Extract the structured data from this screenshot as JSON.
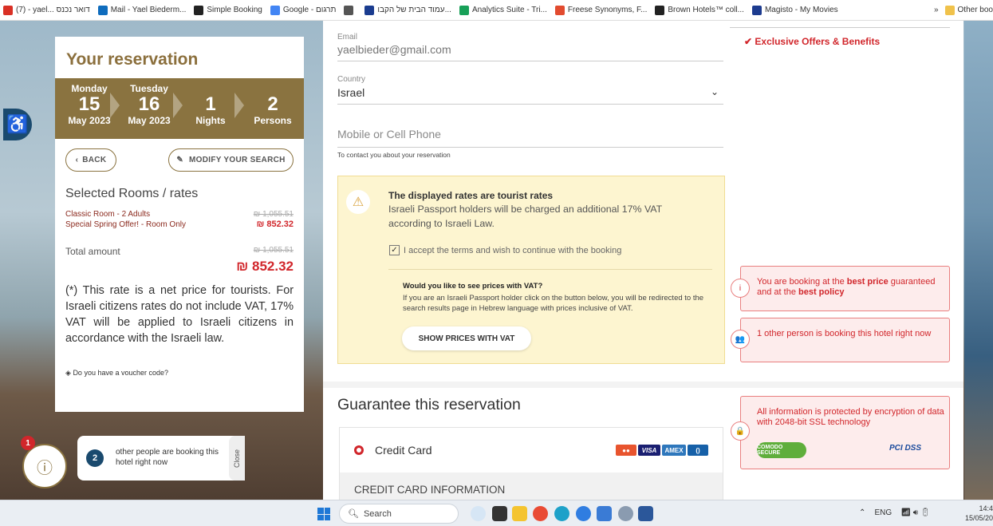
{
  "bookmarks": [
    {
      "label": "(7) - yael... דואר נכנס",
      "icon": "gmail-icon",
      "color": "#d93025"
    },
    {
      "label": "Mail - Yael Biederm...",
      "icon": "outlook-icon",
      "color": "#0f6cbd"
    },
    {
      "label": "Simple Booking",
      "icon": "sb-icon",
      "color": "#222222"
    },
    {
      "label": "Google - תרגום",
      "icon": "translate-icon",
      "color": "#4285f4"
    },
    {
      "label": "",
      "icon": "globe-icon",
      "color": "#555555"
    },
    {
      "label": "עמוד הבית של הקבו...",
      "icon": "b-icon",
      "color": "#1a3c8f"
    },
    {
      "label": "Analytics Suite - Tri...",
      "icon": "analytics-icon",
      "color": "#18a058"
    },
    {
      "label": "Freese Synonyms, F...",
      "icon": "freese-icon",
      "color": "#e24b2f"
    },
    {
      "label": "Brown Hotels™ coll...",
      "icon": "brown-icon",
      "color": "#222222"
    },
    {
      "label": "Magisto - My Movies",
      "icon": "magisto-icon",
      "color": "#1d3b8f"
    }
  ],
  "bookmarks_more": "»",
  "bookmarks_other": "Other boo",
  "reservation": {
    "title": "Your reservation",
    "checkin": {
      "day": "Monday",
      "date": "15",
      "month": "May 2023"
    },
    "checkout": {
      "day": "Tuesday",
      "date": "16",
      "month": "May 2023"
    },
    "nights": {
      "value": "1",
      "label": "Nights"
    },
    "persons": {
      "value": "2",
      "label": "Persons"
    },
    "back_label": "BACK",
    "modify_label": "MODIFY YOUR SEARCH",
    "rooms_heading": "Selected Rooms / rates",
    "room_line1": {
      "label": "Classic Room - 2 Adults",
      "old_price": "₪ 1,055.51"
    },
    "room_line2": {
      "label": "Special Spring Offer! - Room Only",
      "price": "₪ 852.32"
    },
    "total_label": "Total amount",
    "total_old": "₪ 1,055.51",
    "total_new": "₪ 852.32",
    "note": "(*) This rate is a net price for tourists. For Israeli citizens rates do not include VAT, 17% VAT will be applied to Israeli citizens in accordance with the Israeli law.",
    "voucher": "Do you have a voucher code?"
  },
  "form": {
    "email_label": "Email",
    "email_value": "yaelbieder@gmail.com",
    "country_label": "Country",
    "country_value": "Israel",
    "phone_placeholder": "Mobile or Cell Phone",
    "phone_hint": "To contact you about your reservation"
  },
  "notice": {
    "title": "The displayed rates are tourist rates",
    "body": "Israeli Passport holders will be charged an additional 17% VAT according to Israeli Law.",
    "accept": "I accept the terms and wish to continue with the booking",
    "vat_question": "Would you like to see prices with VAT?",
    "vat_body": "If you are an Israeli Passport holder click on the button below, you will be redirected to the search results page in Hebrew language with prices inclusive of VAT.",
    "vat_button": "SHOW PRICES WITH VAT"
  },
  "guarantee": {
    "title": "Guarantee this reservation",
    "method": "Credit Card",
    "cards": [
      "mastercard-icon",
      "visa-icon",
      "amex-icon",
      "diners-icon"
    ],
    "section": "CREDIT CARD INFORMATION"
  },
  "side": {
    "offers": "Exclusive Offers & Benefits",
    "best_price_pre": "You are booking at the ",
    "best_price_b1": "best price",
    "best_price_mid": " guaranteed and at the ",
    "best_price_b2": "best policy",
    "booking_now": "1 other person is booking this hotel right now",
    "security": "All information is protected by encryption of data with 2048-bit SSL technology",
    "comodo": "COMODO SECURE",
    "pci": "PCI DSS"
  },
  "popup": {
    "badge": "1",
    "count": "2",
    "text": "other people are booking this hotel right now",
    "close": "Close"
  },
  "taskbar": {
    "search": "Search",
    "lang": "ENG",
    "time": "14:4",
    "date": "15/05/202"
  }
}
